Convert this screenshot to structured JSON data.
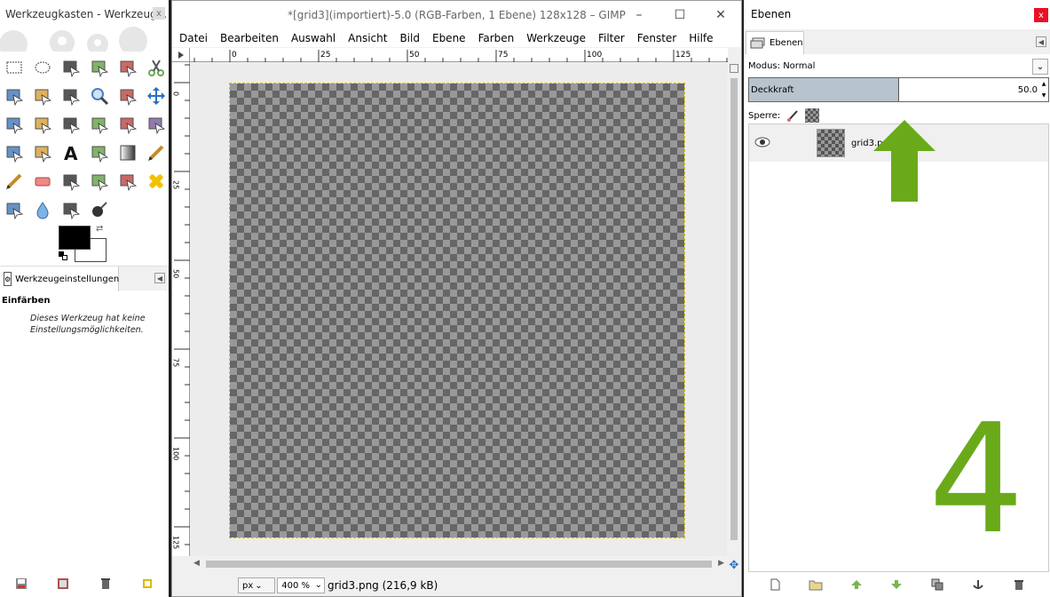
{
  "toolbox": {
    "title": "Werkzeugkasten - Werkzeug...",
    "close_glyph": "x",
    "tool_options_tab": "Werkzeugeinstellungen",
    "tool_name": "Einfärben",
    "tool_message": "Dieses Werkzeug hat keine Einstellungsmöglichkeiten.",
    "fg_color": "#000000",
    "bg_color": "#ffffff",
    "tools": [
      "rect-select-icon",
      "ellipse-select-icon",
      "free-select-icon",
      "fuzzy-select-icon",
      "select-by-color-icon",
      "scissors-icon",
      "foreground-select-icon",
      "paths-icon",
      "color-picker-icon",
      "zoom-icon",
      "measure-icon",
      "move-icon",
      "align-icon",
      "crop-icon",
      "rotate-icon",
      "scale-icon",
      "shear-icon",
      "perspective-icon",
      "flip-icon",
      "cage-icon",
      "text-icon",
      "bucket-fill-icon",
      "gradient-icon",
      "pencil-icon",
      "paintbrush-icon",
      "eraser-icon",
      "airbrush-icon",
      "ink-icon",
      "clone-icon",
      "heal-icon",
      "perspective-clone-icon",
      "blur-icon",
      "smudge-icon",
      "dodge-burn-icon"
    ]
  },
  "image_window": {
    "title": "*[grid3](importiert)-5.0 (RGB-Farben, 1 Ebene) 128x128 – GIMP",
    "window_controls": [
      "–",
      "☐",
      "✕"
    ],
    "menu": [
      {
        "label": "Datei",
        "key": "D"
      },
      {
        "label": "Bearbeiten",
        "key": "B"
      },
      {
        "label": "Auswahl",
        "key": "A"
      },
      {
        "label": "Ansicht",
        "key": "n"
      },
      {
        "label": "Bild",
        "key": "B"
      },
      {
        "label": "Ebene",
        "key": "E"
      },
      {
        "label": "Farben",
        "key": "F"
      },
      {
        "label": "Werkzeuge",
        "key": "W"
      },
      {
        "label": "Filter",
        "key": "r"
      },
      {
        "label": "Fenster",
        "key": "F"
      },
      {
        "label": "Hilfe",
        "key": "H"
      }
    ],
    "ruler_h_labels": [
      "0",
      "25",
      "50",
      "75",
      "100",
      "125"
    ],
    "ruler_v_labels": [
      "0",
      "25",
      "50",
      "75",
      "100",
      "125"
    ],
    "unit": "px",
    "zoom": "400 %",
    "status": "grid3.png (216,9 kB)"
  },
  "layers_dock": {
    "title": "Ebenen",
    "tab_label": "Ebenen",
    "mode_label": "Modus: Normal",
    "opacity_label": "Deckkraft",
    "opacity_value": "50.0",
    "opacity_fraction": 0.5,
    "lock_label": "Sperre:",
    "layers": [
      {
        "name": "grid3.png",
        "visible": true
      }
    ],
    "annotation_number": "4",
    "annotation_color": "#6aaa1a"
  }
}
